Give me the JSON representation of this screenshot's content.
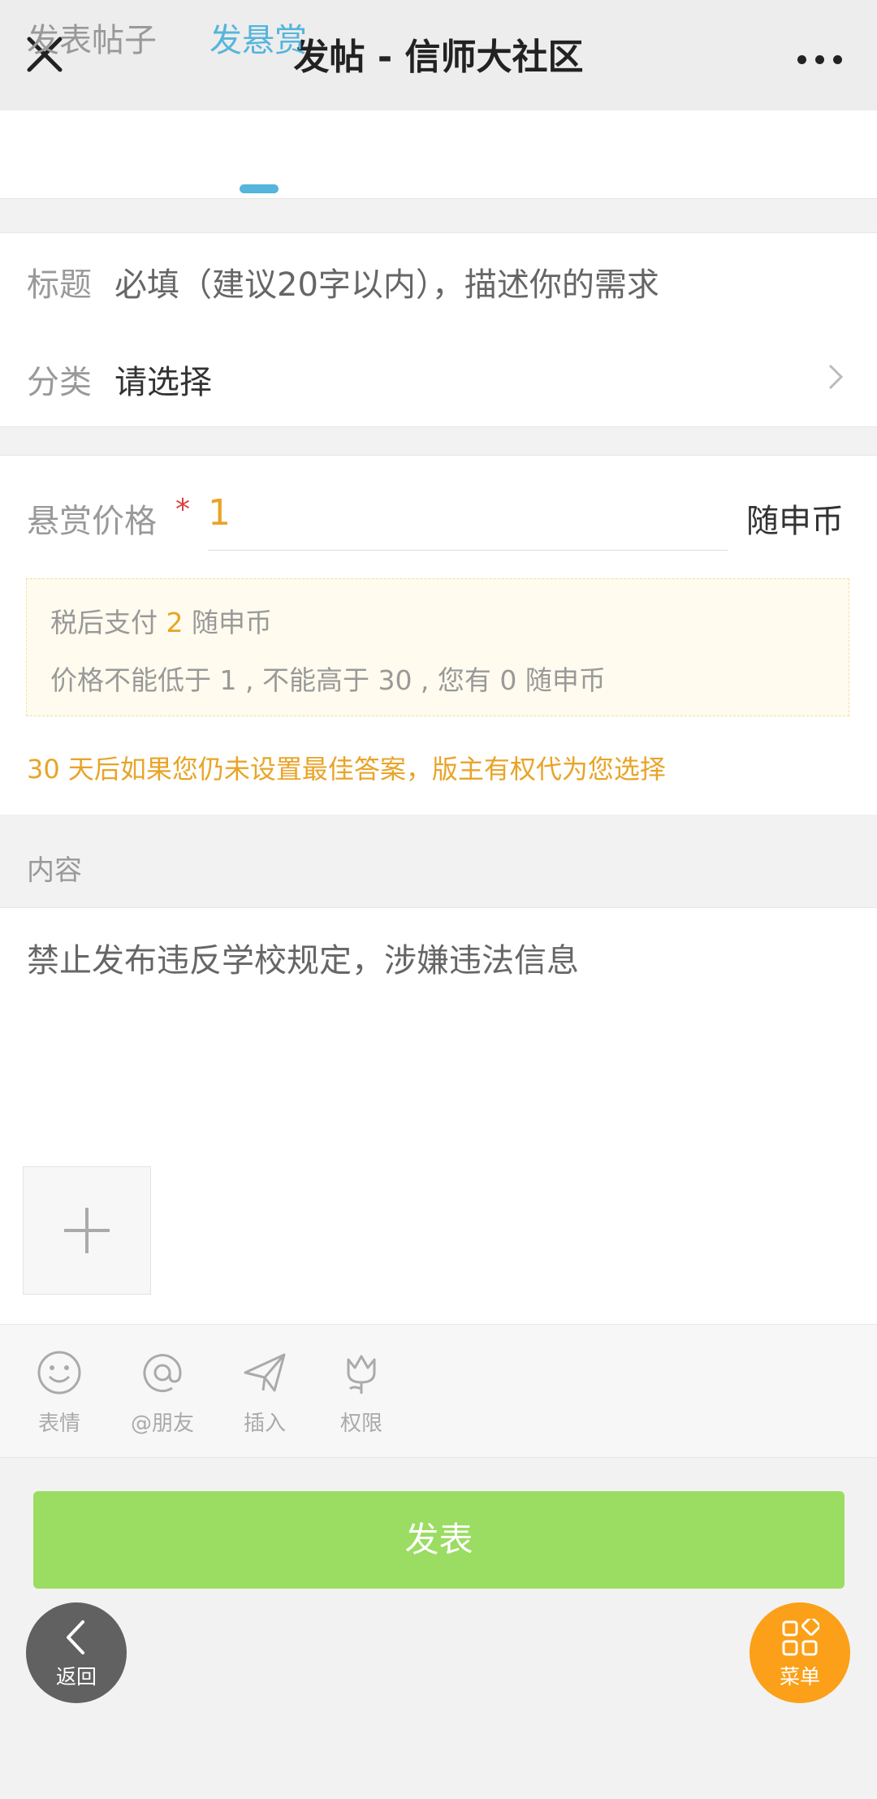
{
  "header": {
    "title": "发帖 - 信师大社区",
    "close_icon": "close-icon",
    "more_icon": "more-horizontal-icon"
  },
  "tabs": [
    {
      "label": "发表帖子",
      "active": false
    },
    {
      "label": "发悬赏",
      "active": true
    }
  ],
  "form": {
    "title": {
      "label": "标题",
      "placeholder": "必填（建议20字以内），描述你的需求"
    },
    "category": {
      "label": "分类",
      "value": "请选择",
      "chevron_icon": "chevron-right-icon"
    }
  },
  "reward": {
    "price_label": "悬赏价格",
    "required_mark": "*",
    "price_value": "1",
    "unit": "随申币",
    "tip_pay_prefix": "税后支付",
    "tip_pay_amount": "2",
    "tip_pay_unit": "随申币",
    "tip_range": "价格不能低于 1 , 不能高于 30 , 您有 0 随申币",
    "notice": "30 天后如果您仍未设置最佳答案，版主有权代为您选择"
  },
  "content": {
    "section_label": "内容",
    "placeholder": "禁止发布违反学校规定，涉嫌违法信息",
    "add_icon": "plus-icon"
  },
  "toolbar": [
    {
      "label": "表情",
      "icon": "smiley-icon"
    },
    {
      "label": "@朋友",
      "icon": "at-icon"
    },
    {
      "label": "插入",
      "icon": "paper-plane-icon"
    },
    {
      "label": "权限",
      "icon": "tulip-icon"
    }
  ],
  "publish_button": {
    "label": "发表"
  },
  "fab": {
    "back_label": "返回",
    "menu_label": "菜单"
  },
  "colors": {
    "accent_tab": "#55b5dc",
    "price_orange": "#e8a428",
    "publish_green": "#9bdc62",
    "menu_orange": "#fba018",
    "back_gray": "#616161"
  }
}
